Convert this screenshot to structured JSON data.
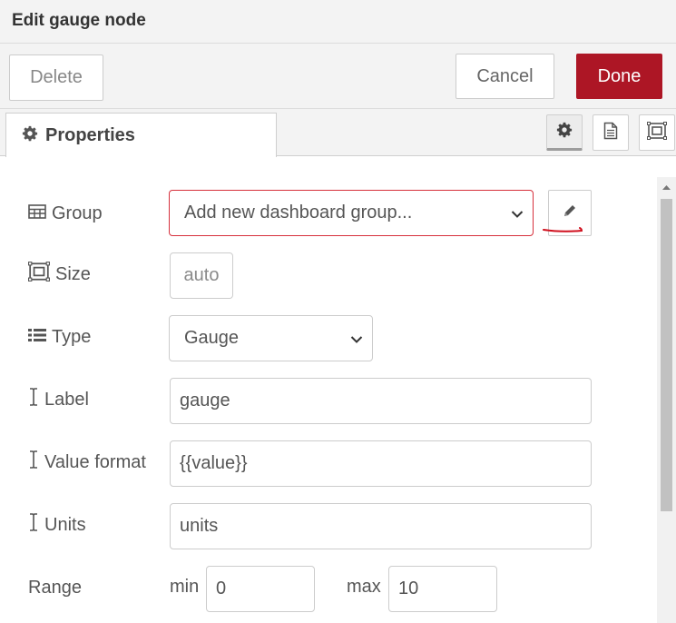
{
  "dialog": {
    "title": "Edit gauge node"
  },
  "toolbar": {
    "delete_label": "Delete",
    "cancel_label": "Cancel",
    "done_label": "Done",
    "done_color": "#ad1625"
  },
  "tabs": {
    "properties_label": "Properties",
    "icons": [
      "gear-icon",
      "document-icon",
      "layout-icon"
    ]
  },
  "form": {
    "group": {
      "label": "Group",
      "value": "Add new dashboard group...",
      "icon": "table-icon",
      "edit_icon": "pencil-icon"
    },
    "size": {
      "label": "Size",
      "value": "auto",
      "icon": "resize-icon"
    },
    "type": {
      "label": "Type",
      "value": "Gauge",
      "icon": "list-icon"
    },
    "label": {
      "label": "Label",
      "value": "gauge",
      "icon": "text-cursor-icon"
    },
    "value_format": {
      "label": "Value format",
      "value": "{{value}}",
      "icon": "text-cursor-icon"
    },
    "units": {
      "label": "Units",
      "value": "units",
      "icon": "text-cursor-icon"
    },
    "range": {
      "label": "Range",
      "min_label": "min",
      "min_value": "0",
      "max_label": "max",
      "max_value": "10"
    }
  },
  "colors": {
    "error_border": "#d6303c",
    "annotation": "#d0101e"
  }
}
